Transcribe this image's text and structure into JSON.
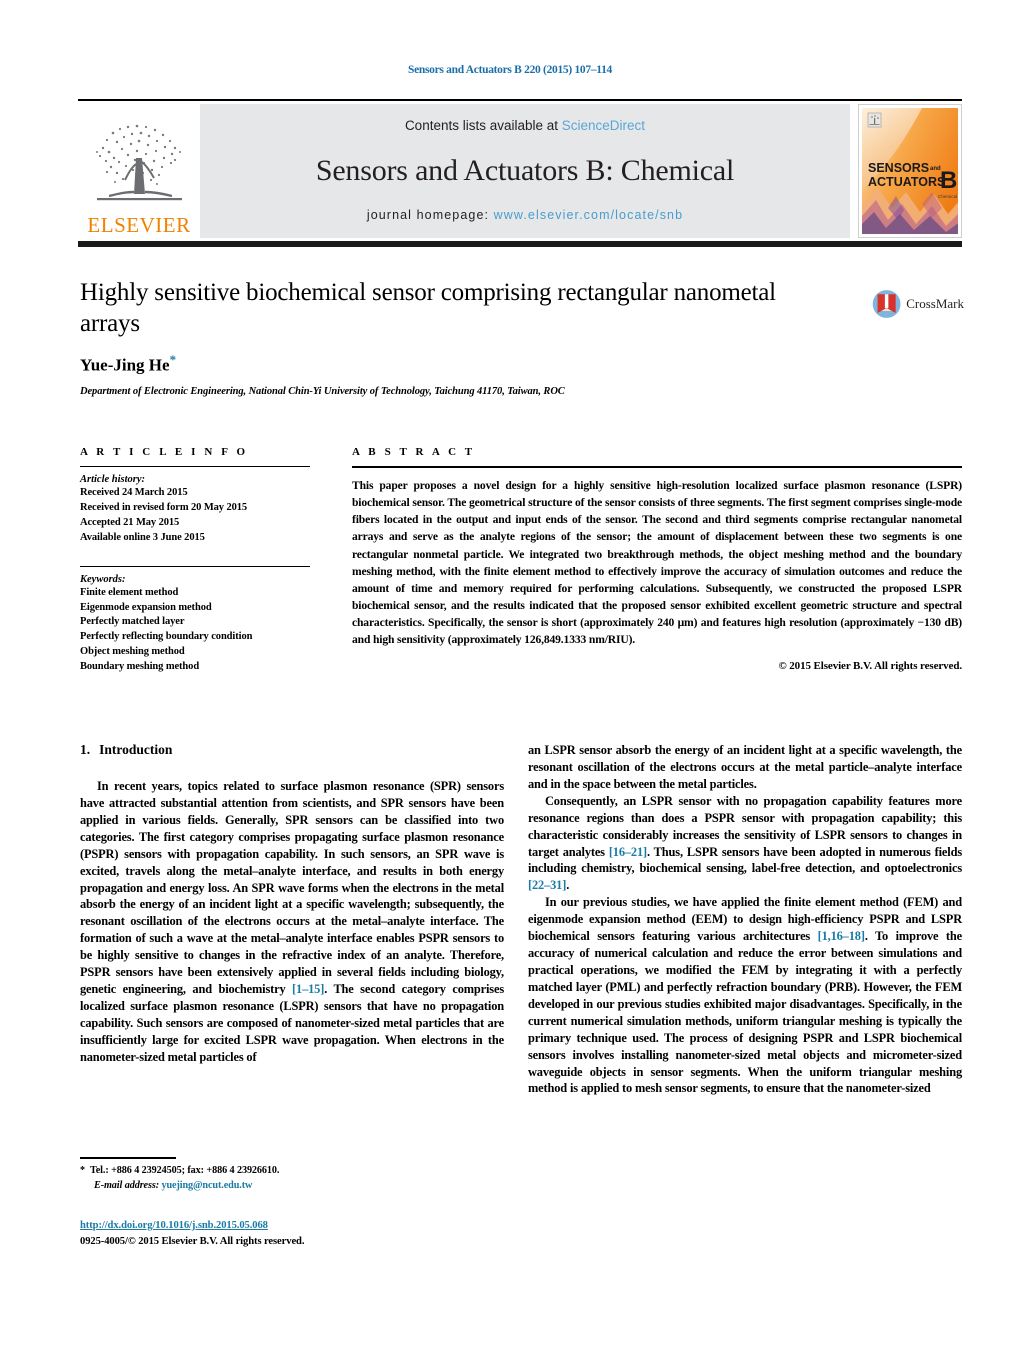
{
  "colors": {
    "runhead_blue": "#1a6fa8",
    "link_blue": "#1a7ba5",
    "sciencedirect_blue": "#5aa7d4",
    "elsevier_orange": "#ef8200",
    "masthead_gray": "#e6e7e8"
  },
  "running_head": "Sensors and Actuators B 220 (2015) 107–114",
  "masthead": {
    "publisher_name": "ELSEVIER",
    "contents_prefix": "Contents lists available at ",
    "contents_link": "ScienceDirect",
    "journal_title": "Sensors and Actuators B: Chemical",
    "homepage_prefix": "journal homepage: ",
    "homepage_url": "www.elsevier.com/locate/snb",
    "cover": {
      "line1": "SENSORS",
      "line1_small": "and",
      "line2": "ACTUATORS",
      "letter": "B",
      "letter_sub": "Chemical"
    }
  },
  "article": {
    "title": "Highly sensitive biochemical sensor comprising rectangular nanometal arrays",
    "authors": "Yue-Jing He",
    "author_marker": "*",
    "affiliation": "Department of Electronic Engineering, National Chin-Yi University of Technology, Taichung 41170, Taiwan, ROC",
    "crossmark_label": "CrossMark"
  },
  "article_info": {
    "heading": "A R T I C L E   I N F O",
    "history_label": "Article history:",
    "history": [
      "Received 24 March 2015",
      "Received in revised form 20 May 2015",
      "Accepted 21 May 2015",
      "Available online 3 June 2015"
    ],
    "keywords_label": "Keywords:",
    "keywords": [
      "Finite element method",
      "Eigenmode expansion method",
      "Perfectly matched layer",
      "Perfectly reflecting boundary condition",
      "Object meshing method",
      "Boundary meshing method"
    ]
  },
  "abstract": {
    "heading": "A B S T R A C T",
    "text": "This paper proposes a novel design for a highly sensitive high-resolution localized surface plasmon resonance (LSPR) biochemical sensor. The geometrical structure of the sensor consists of three segments. The first segment comprises single-mode fibers located in the output and input ends of the sensor. The second and third segments comprise rectangular nanometal arrays and serve as the analyte regions of the sensor; the amount of displacement between these two segments is one rectangular nonmetal particle. We integrated two breakthrough methods, the object meshing method and the boundary meshing method, with the finite element method to effectively improve the accuracy of simulation outcomes and reduce the amount of time and memory required for performing calculations. Subsequently, we constructed the proposed LSPR biochemical sensor, and the results indicated that the proposed sensor exhibited excellent geometric structure and spectral characteristics. Specifically, the sensor is short (approximately 240 μm) and features high resolution (approximately −130 dB) and high sensitivity (approximately 126,849.1333 nm/RIU).",
    "copyright": "© 2015 Elsevier B.V. All rights reserved."
  },
  "sections": {
    "intro_number": "1.",
    "intro_title": "Introduction"
  },
  "body": {
    "left_paragraphs": [
      "In recent years, topics related to surface plasmon resonance (SPR) sensors have attracted substantial attention from scientists, and SPR sensors have been applied in various fields. Generally, SPR sensors can be classified into two categories. The first category comprises propagating surface plasmon resonance (PSPR) sensors with propagation capability. In such sensors, an SPR wave is excited, travels along the metal–analyte interface, and results in both energy propagation and energy loss. An SPR wave forms when the electrons in the metal absorb the energy of an incident light at a specific wavelength; subsequently, the resonant oscillation of the electrons occurs at the metal–analyte interface. The formation of such a wave at the metal–analyte interface enables PSPR sensors to be highly sensitive to changes in the refractive index of an analyte. Therefore, PSPR sensors have been extensively applied in several fields including biology, genetic engineering, and biochemistry [1–15]. The second category comprises localized surface plasmon resonance (LSPR) sensors that have no propagation capability. Such sensors are composed of nanometer-sized metal particles that are insufficiently large for excited LSPR wave propagation. When electrons in the nanometer-sized metal particles of"
    ],
    "right_paragraphs": [
      "an LSPR sensor absorb the energy of an incident light at a specific wavelength, the resonant oscillation of the electrons occurs at the metal particle–analyte interface and in the space between the metal particles.",
      "Consequently, an LSPR sensor with no propagation capability features more resonance regions than does a PSPR sensor with propagation capability; this characteristic considerably increases the sensitivity of LSPR sensors to changes in target analytes [16–21]. Thus, LSPR sensors have been adopted in numerous fields including chemistry, biochemical sensing, label-free detection, and optoelectronics [22–31].",
      "In our previous studies, we have applied the finite element method (FEM) and eigenmode expansion method (EEM) to design high-efficiency PSPR and LSPR biochemical sensors featuring various architectures [1,16–18]. To improve the accuracy of numerical calculation and reduce the error between simulations and practical operations, we modified the FEM by integrating it with a perfectly matched layer (PML) and perfectly refraction boundary (PRB). However, the FEM developed in our previous studies exhibited major disadvantages. Specifically, in the current numerical simulation methods, uniform triangular meshing is typically the primary technique used. The process of designing PSPR and LSPR biochemical sensors involves installing nanometer-sized metal objects and micrometer-sized waveguide objects in sensor segments. When the uniform triangular meshing method is applied to mesh sensor segments, to ensure that the nanometer-sized"
    ],
    "citations": [
      "[1–15]",
      "[16–21]",
      "[22–31]",
      "[1,16–18]"
    ]
  },
  "footnotes": {
    "star": "*",
    "contact": "Tel.: +886 4 23924505; fax: +886 4 23926610.",
    "email_label": "E-mail address:",
    "email": "yuejing@ncut.edu.tw",
    "doi_url": "http://dx.doi.org/10.1016/j.snb.2015.05.068",
    "issn_line": "0925-4005/© 2015 Elsevier B.V. All rights reserved."
  }
}
